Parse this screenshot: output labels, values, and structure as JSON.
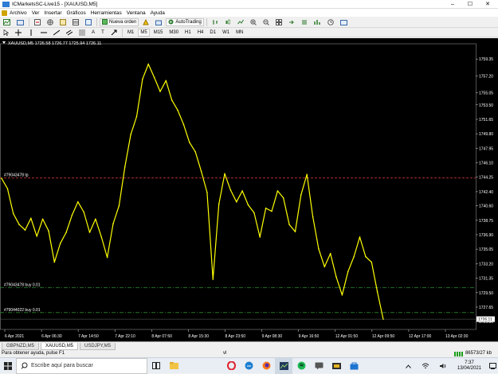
{
  "window": {
    "title": "ICMarketsSC-Live15 - [XAUUSD,M5]",
    "buttons": [
      "–",
      "☐",
      "✕"
    ]
  },
  "menu": {
    "items": [
      "Archivo",
      "Ver",
      "Insertar",
      "Gráficos",
      "Herramientas",
      "Ventana",
      "Ayuda"
    ]
  },
  "toolbar": {
    "new_order": "Nueva orden",
    "autotrading": "AutoTrading",
    "periods": [
      "M1",
      "M5",
      "M15",
      "M30",
      "H1",
      "H4",
      "D1",
      "W1",
      "MN"
    ],
    "draw_text_tool": "A",
    "draw_label_tool": "T"
  },
  "chart": {
    "header": "XAUUSD,M5  1726.58 1726.77 1725.94 1726.11",
    "order_labels": {
      "tp": "#79043478 tp",
      "buy1": "#79043478 buy 0.01",
      "buy2": "#79044022 buy 0.01"
    },
    "current_price_tag": "1726.11",
    "colors": {
      "background": "#000000",
      "price_line": "#ffff00",
      "axis_text": "#ffffff",
      "tp_line": "#c83232",
      "order_line": "#2a8a2a"
    }
  },
  "chart_data": {
    "type": "line",
    "symbol": "XAUUSD",
    "timeframe": "M5",
    "ohlc": {
      "open": 1726.58,
      "high": 1726.77,
      "low": 1725.94,
      "close": 1726.11
    },
    "ylim": [
      1725.0,
      1761.0
    ],
    "yticks": [
      1759.35,
      1757.2,
      1755.05,
      1753.5,
      1751.65,
      1749.8,
      1747.95,
      1746.1,
      1744.25,
      1742.4,
      1740.6,
      1738.75,
      1736.9,
      1735.05,
      1733.2,
      1731.35,
      1729.5,
      1727.65,
      1725.8
    ],
    "ytick_labels": [
      "1759.35",
      "1757.20",
      "1755.05",
      "1753.50",
      "1751.65",
      "1749.80",
      "1747.95",
      "1746.10",
      "1744.25",
      "1742.40",
      "1740.60",
      "1738.75",
      "1736.90",
      "1735.05",
      "1733.20",
      "1731.35",
      "1729.50",
      "1727.65",
      "1725.80"
    ],
    "xticks": [
      "6 Apr 2021",
      "6 Apr 06:30",
      "7 Apr 14:50",
      "7 Apr 22:10",
      "8 Apr 07:50",
      "8 Apr 15:30",
      "8 Apr 23:50",
      "9 Apr 08:30",
      "9 Apr 16:50",
      "12 Apr 01:50",
      "12 Apr 09:50",
      "12 Apr 17:00",
      "13 Apr 02:30"
    ],
    "series": [
      {
        "values": [
          1744.1,
          1742.8,
          1739.6,
          1738.2,
          1737.5,
          1739.0,
          1736.7,
          1738.9,
          1737.4,
          1733.4,
          1735.8,
          1737.2,
          1739.4,
          1741.1,
          1739.8,
          1737.2,
          1738.9,
          1736.6,
          1734.0,
          1738.3,
          1740.6,
          1745.6,
          1749.7,
          1752.0,
          1756.8,
          1758.7,
          1757.0,
          1755.2,
          1756.6,
          1754.1,
          1752.8,
          1751.0,
          1748.7,
          1747.5,
          1745.0,
          1742.3,
          1731.2,
          1740.8,
          1744.7,
          1742.6,
          1741.1,
          1742.5,
          1740.7,
          1739.7,
          1736.6,
          1740.3,
          1739.9,
          1742.5,
          1741.6,
          1738.2,
          1737.3,
          1742.0,
          1744.6,
          1739.2,
          1735.1,
          1732.8,
          1734.5,
          1731.5,
          1729.2,
          1732.2,
          1734.1,
          1736.6,
          1734.1,
          1733.4,
          1729.6,
          1726.1
        ]
      }
    ],
    "horizontal_lines": [
      {
        "label": "#79043478 tp",
        "value": 1744.15,
        "style": "dashed"
      },
      {
        "label": "#79043478 buy 0.01",
        "value": 1730.15,
        "style": "dash-dot"
      },
      {
        "label": "#79044022 buy 0.01",
        "value": 1726.95,
        "style": "dash-dot"
      }
    ],
    "grid": false
  },
  "symbol_tabs": [
    "GBPNZD,M5",
    "XAUUSD,M5",
    "USDJPY,M5"
  ],
  "active_tab": "XAUUSD,M5",
  "status": {
    "help": "Para obtener ayuda, pulse F1",
    "profile": "vl",
    "traffic": "86573/27 kb"
  },
  "taskbar": {
    "search_placeholder": "Escribe aquí para buscar",
    "time": "7:37",
    "date": "13/04/2021",
    "apps": [
      "task-view",
      "file-explorer",
      "opera",
      "edge",
      "firefox",
      "metatrader",
      "spotify",
      "chat",
      "folder",
      "windows-store"
    ]
  }
}
